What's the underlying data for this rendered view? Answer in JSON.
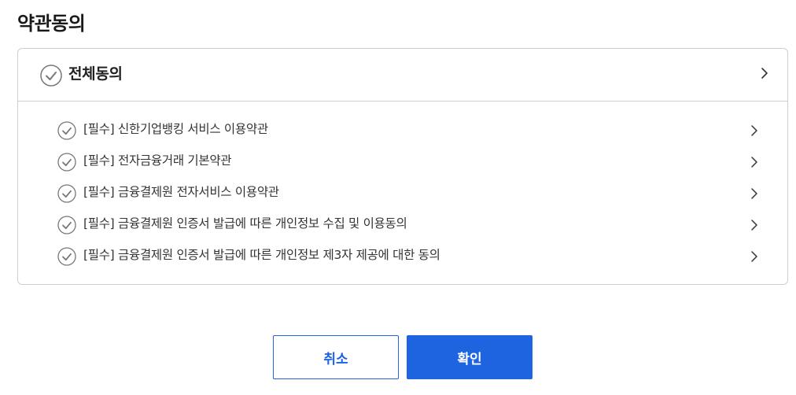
{
  "page": {
    "title": "약관동의"
  },
  "agree_all": {
    "label": "전체동의",
    "checked": false
  },
  "terms": [
    {
      "label": "[필수] 신한기업뱅킹 서비스 이용약관",
      "checked": false
    },
    {
      "label": "[필수] 전자금융거래 기본약관",
      "checked": false
    },
    {
      "label": "[필수] 금융결제원 전자서비스 이용약관",
      "checked": false
    },
    {
      "label": "[필수] 금융결제원 인증서 발급에 따른 개인정보 수집 및 이용동의",
      "checked": false
    },
    {
      "label": "[필수] 금융결제원 인증서 발급에 따른 개인정보 제3자 제공에 대한 동의",
      "checked": false
    }
  ],
  "buttons": {
    "cancel_label": "취소",
    "confirm_label": "확인"
  },
  "colors": {
    "accent": "#1e63e0",
    "border": "#cfcfcf",
    "check_icon": "#777777"
  },
  "icons": {
    "check": "check-circle-icon",
    "chevron": "chevron-right-icon"
  }
}
